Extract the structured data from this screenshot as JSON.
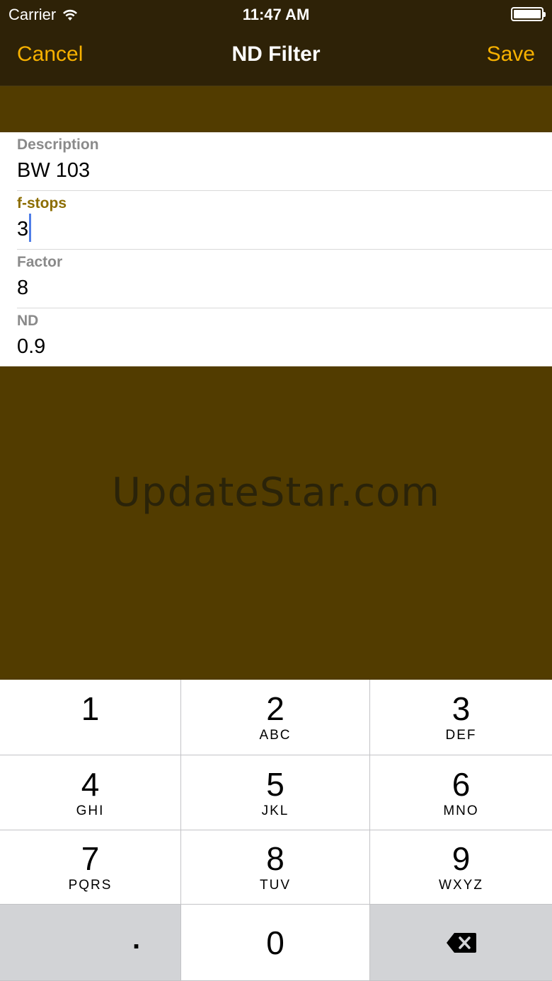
{
  "status": {
    "carrier": "Carrier",
    "time": "11:47 AM"
  },
  "nav": {
    "cancel": "Cancel",
    "title": "ND Filter",
    "save": "Save",
    "accent": "#f7b100"
  },
  "form": {
    "fields": [
      {
        "label": "Description",
        "value": "BW 103"
      },
      {
        "label": "f-stops",
        "value": "3"
      },
      {
        "label": "Factor",
        "value": "8"
      },
      {
        "label": "ND",
        "value": "0.9"
      }
    ]
  },
  "watermark": "UpdateStar.com",
  "keypad": {
    "keys": [
      {
        "digit": "1",
        "letters": ""
      },
      {
        "digit": "2",
        "letters": "ABC"
      },
      {
        "digit": "3",
        "letters": "DEF"
      },
      {
        "digit": "4",
        "letters": "GHI"
      },
      {
        "digit": "5",
        "letters": "JKL"
      },
      {
        "digit": "6",
        "letters": "MNO"
      },
      {
        "digit": "7",
        "letters": "PQRS"
      },
      {
        "digit": "8",
        "letters": "TUV"
      },
      {
        "digit": "9",
        "letters": "WXYZ"
      },
      {
        "digit": ".",
        "letters": ""
      },
      {
        "digit": "0",
        "letters": ""
      }
    ],
    "delete_icon": "backspace-icon"
  }
}
